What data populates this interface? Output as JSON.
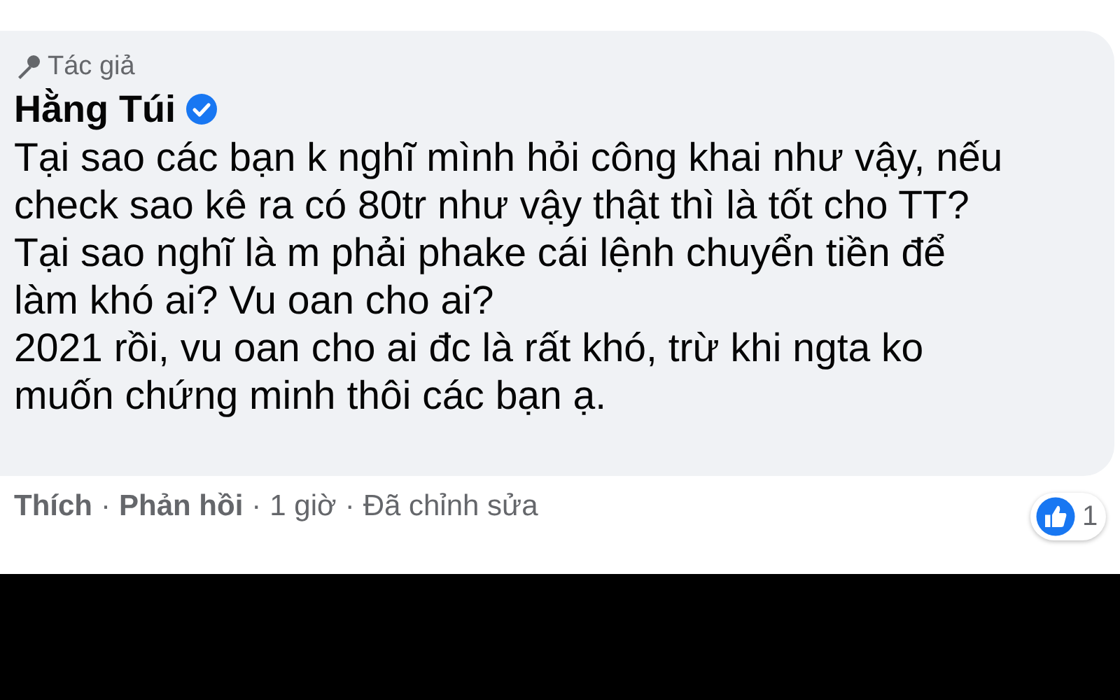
{
  "comment": {
    "badge": "Tác giả",
    "author": "Hằng Túi",
    "verified": true,
    "lines": [
      "Tại sao các bạn k nghĩ mình hỏi công khai như vậy, nếu",
      "check sao kê ra có 80tr như vậy thật thì là tốt cho TT?",
      "Tại sao nghĩ là m phải phake cái lệnh chuyển tiền để",
      "làm khó ai? Vu oan cho ai?",
      "2021 rồi, vu oan cho ai đc là rất khó, trừ khi ngta ko",
      "muốn chứng minh thôi các bạn ạ."
    ],
    "reaction_count": "1"
  },
  "separator": "·",
  "actions": [
    {
      "label": "Thích",
      "kind": "link"
    },
    {
      "label": "Phản hồi",
      "kind": "link"
    },
    {
      "label": "1 giờ",
      "kind": "meta"
    },
    {
      "label": "Đã chỉnh sửa",
      "kind": "meta"
    }
  ]
}
